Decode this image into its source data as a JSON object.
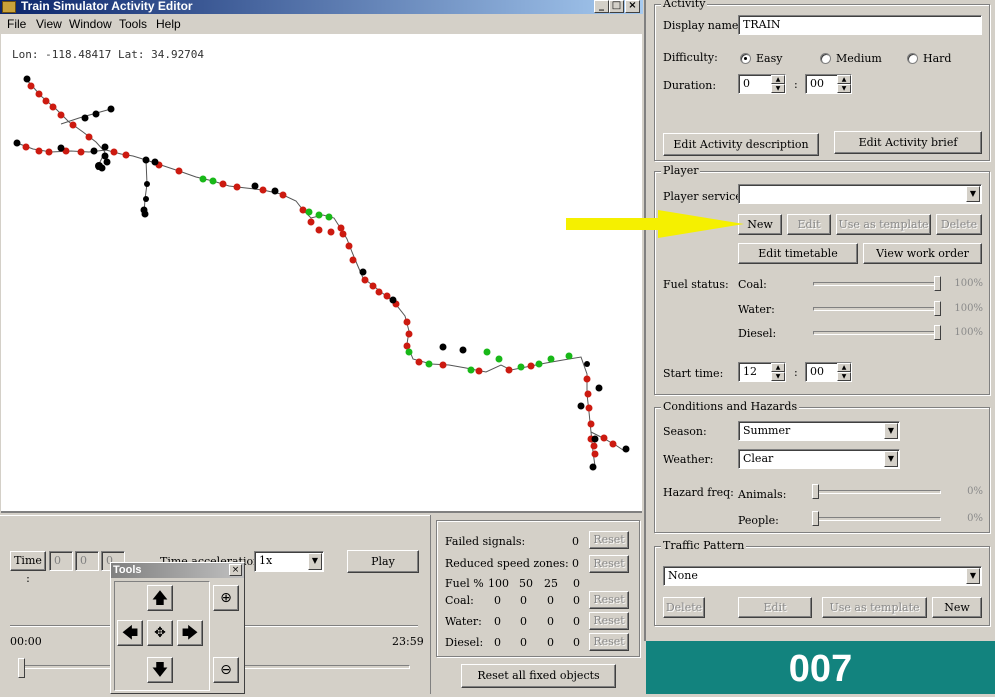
{
  "window": {
    "title": "Train Simulator Activity Editor",
    "controls": [
      "_",
      "□",
      "×"
    ]
  },
  "menu": [
    "File",
    "View",
    "Window",
    "Tools",
    "Help"
  ],
  "map": {
    "coords": "Lon: -118.48417 Lat: 34.92704",
    "colors": {
      "track_red": "#cc1a10",
      "track_green": "#18b818",
      "track_black": "#000000"
    }
  },
  "time_panel": {
    "time_label": "Time :",
    "time_fields": [
      "0",
      "0",
      "0"
    ],
    "acceleration_label_partial": "Time acceleration",
    "acceleration_value": "1x",
    "play_label": "Play",
    "start_label": "00:00",
    "end_label": "23:59",
    "slider_position": 0.0
  },
  "tools_window": {
    "title": "Tools",
    "close": "×",
    "icons": [
      "arrow-up-icon",
      "arrow-left-icon",
      "center-move-icon",
      "arrow-right-icon",
      "arrow-down-icon",
      "zoom-in-icon",
      "zoom-out-icon"
    ]
  },
  "stats": {
    "failed_signals_label": "Failed signals:",
    "failed_signals_value": "0",
    "reduced_speed_label": "Reduced speed zones:",
    "reduced_speed_value": "0",
    "reset_label": "Reset",
    "fuel_header": [
      "Fuel %",
      "100",
      "50",
      "25",
      "0"
    ],
    "fuel_rows": [
      {
        "label": "Coal:",
        "values": [
          "0",
          "0",
          "0",
          "0"
        ]
      },
      {
        "label": "Water:",
        "values": [
          "0",
          "0",
          "0",
          "0"
        ]
      },
      {
        "label": "Diesel:",
        "values": [
          "0",
          "0",
          "0",
          "0"
        ]
      }
    ],
    "reset_all_label": "Reset all fixed objects"
  },
  "activity": {
    "group_title": "Activity",
    "display_name_label": "Display name:",
    "display_name_value": "TRAIN",
    "difficulty_label": "Difficulty:",
    "difficulty_options": [
      "Easy",
      "Medium",
      "Hard"
    ],
    "difficulty_selected": "Easy",
    "duration_label": "Duration:",
    "duration_hours": "0",
    "duration_minutes": "00",
    "edit_description_label": "Edit Activity description",
    "edit_brief_label": "Edit Activity brief"
  },
  "player": {
    "group_title": "Player",
    "service_label": "Player service:",
    "service_value": "",
    "new_label": "New",
    "edit_label": "Edit",
    "template_label": "Use as template",
    "delete_label": "Delete",
    "edit_timetable_label": "Edit timetable",
    "view_work_order_label": "View work order",
    "fuel_status_label": "Fuel status:",
    "fuel": [
      {
        "label": "Coal:",
        "value": "100%",
        "level": 1.0
      },
      {
        "label": "Water:",
        "value": "100%",
        "level": 1.0
      },
      {
        "label": "Diesel:",
        "value": "100%",
        "level": 1.0
      }
    ],
    "start_time_label": "Start time:",
    "start_hours": "12",
    "start_minutes": "00"
  },
  "conditions": {
    "group_title": "Conditions and Hazards",
    "season_label": "Season:",
    "season_value": "Summer",
    "weather_label": "Weather:",
    "weather_value": "Clear",
    "hazard_label": "Hazard freq:",
    "animals_label": "Animals:",
    "animals_value": "0%",
    "animals_level": 0.0,
    "people_label": "People:",
    "people_value": "0%",
    "people_level": 0.0
  },
  "traffic": {
    "group_title": "Traffic Pattern",
    "pattern_value": "None",
    "delete_label": "Delete",
    "edit_label": "Edit",
    "template_label": "Use as template",
    "new_label": "New"
  },
  "overlay": {
    "badge_text": "007",
    "arrow_color": "#f5f000"
  }
}
